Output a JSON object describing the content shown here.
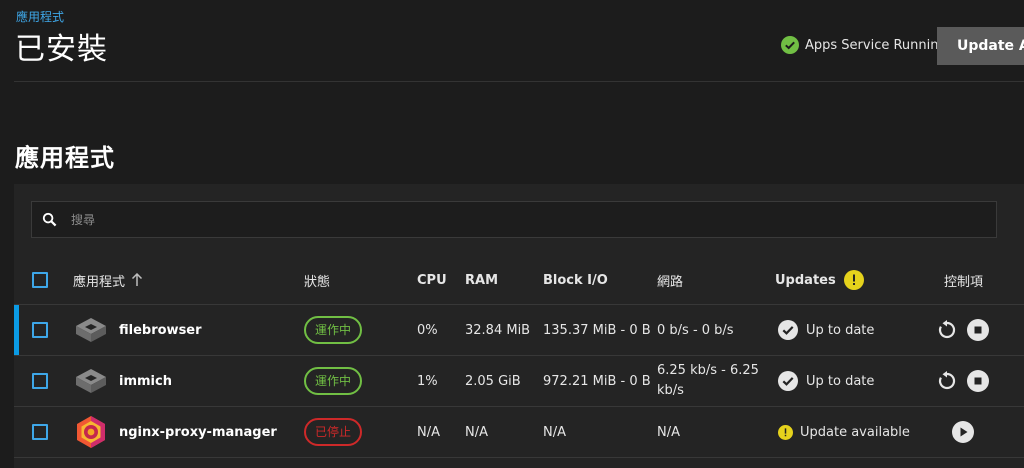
{
  "header": {
    "breadcrumb": "應用程式",
    "title": "已安裝",
    "service_status": "Apps Service Running",
    "update_button": "Update All"
  },
  "section_title": "應用程式",
  "search": {
    "placeholder": "搜尋"
  },
  "table": {
    "columns": {
      "app": "應用程式",
      "state": "狀態",
      "cpu": "CPU",
      "ram": "RAM",
      "block_io": "Block I/O",
      "network": "網路",
      "updates": "Updates",
      "controls": "控制項"
    },
    "rows": [
      {
        "name": "filebrowser",
        "state": "運作中",
        "cpu": "0%",
        "ram": "32.84 MiB",
        "block_io": "135.37 MiB - 0 B",
        "network": "0 b/s - 0 b/s",
        "update": "Up to date"
      },
      {
        "name": "immich",
        "state": "運作中",
        "cpu": "1%",
        "ram": "2.05 GiB",
        "block_io": "972.21 MiB - 0 B",
        "network": "6.25 kb/s - 6.25 kb/s",
        "update": "Up to date"
      },
      {
        "name": "nginx-proxy-manager",
        "state": "已停止",
        "cpu": "N/A",
        "ram": "N/A",
        "block_io": "N/A",
        "network": "N/A",
        "update": "Update available"
      }
    ]
  },
  "colors": {
    "accent": "#3ea7e8",
    "running": "#71bf44",
    "stopped": "#ce2929",
    "warning": "#e5d21c",
    "selected_bar": "#0b9be5"
  }
}
